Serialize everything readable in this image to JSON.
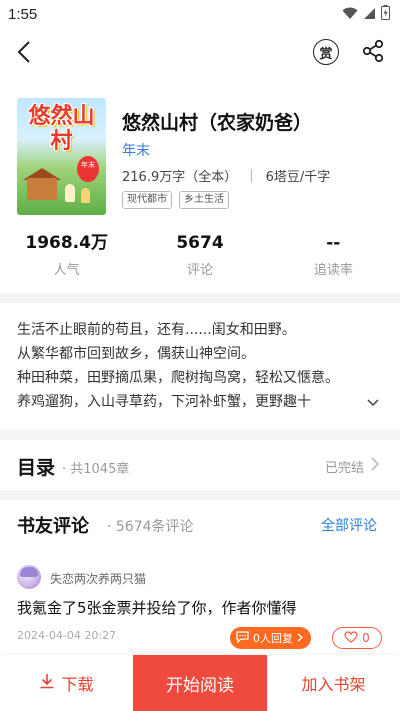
{
  "status_bar": {
    "time": "1:55",
    "wifi_icon": "wifi-icon",
    "signal_icon": "signal-icon",
    "battery_icon": "battery-charging-icon"
  },
  "nav": {
    "back_icon": "back-arrow-icon",
    "reward_label": "赏",
    "share_icon": "share-icon"
  },
  "book": {
    "cover_title": "悠然山村",
    "cover_badge": "年末",
    "title": "悠然山村（农家奶爸）",
    "author": "年末",
    "word_count": "216.9万字（全本）",
    "price": "6塔豆/千字",
    "tags": [
      "现代都市",
      "乡土生活"
    ]
  },
  "stats": [
    {
      "value": "1968.4万",
      "label": "人气"
    },
    {
      "value": "5674",
      "label": "评论"
    },
    {
      "value": "--",
      "label": "追读率"
    }
  ],
  "intro": {
    "lines": [
      "生活不止眼前的苟且，还有......闺女和田野。",
      "从繁华都市回到故乡，偶获山神空间。",
      "种田种菜，田野摘瓜果，爬树掏鸟窝，轻松又惬意。",
      "养鸡遛狗，入山寻草药，下河补虾蟹，更野趣十"
    ],
    "expand_icon": "chevron-down-icon"
  },
  "toc": {
    "title": "目录",
    "count": "· 共1045章",
    "status": "已完结"
  },
  "comments": {
    "title": "书友评论",
    "count": "· 5674条评论",
    "all_label": "全部评论",
    "items": [
      {
        "user": "失恋两次养两只猫",
        "text": "我氪金了5张金票并投给了你，作者你懂得",
        "date": "2024-04-04 20:27",
        "reply_label": "0人回复",
        "likes": "0"
      }
    ]
  },
  "bottom": {
    "download_label": "下载",
    "read_label": "开始阅读",
    "shelf_label": "加入书架"
  },
  "colors": {
    "accent_red": "#f04a3e",
    "link_blue": "#2a7fe0",
    "reply_orange": "#ff6a20"
  }
}
